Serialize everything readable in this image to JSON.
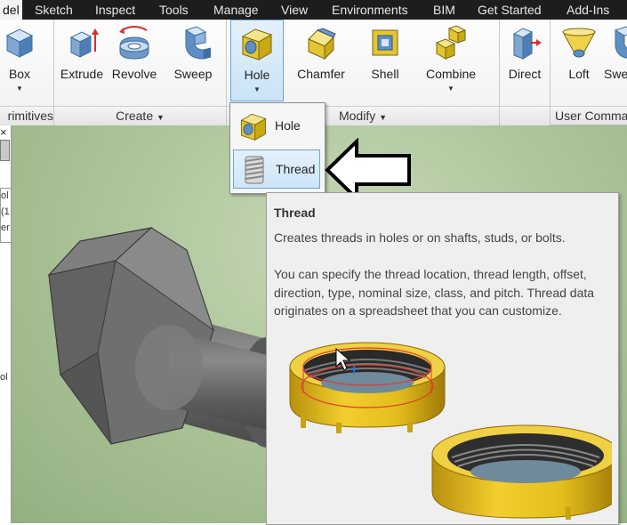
{
  "tabs": [
    "del",
    "Sketch",
    "Inspect",
    "Tools",
    "Manage",
    "View",
    "Environments",
    "BIM",
    "Get Started",
    "Add-Ins"
  ],
  "ribbon": {
    "buttons": {
      "box": "Box",
      "extrude": "Extrude",
      "revolve": "Revolve",
      "sweep": "Sweep",
      "hole": "Hole",
      "chamfer": "Chamfer",
      "shell": "Shell",
      "combine": "Combine",
      "direct": "Direct",
      "loft": "Loft",
      "sweep2": "Swe"
    },
    "panels": {
      "primitives": "rimitives",
      "create": "Create",
      "modify": "Modify",
      "user_commands": "User Comma"
    },
    "panel_arrow": "▼",
    "button_arrow": "▼"
  },
  "browser": {
    "close": "×",
    "fragments": [
      "ol",
      "(1",
      "er",
      "ol"
    ]
  },
  "hole_dropdown": {
    "items": [
      {
        "label": "Hole",
        "icon": "hole-icon"
      },
      {
        "label": "Thread",
        "icon": "thread-icon",
        "highlighted": true
      }
    ]
  },
  "tooltip": {
    "title": "Thread",
    "summary": "Creates threads in holes or on shafts, studs, or bolts.",
    "details": "You can specify the thread location, thread length, offset, direction, type, nominal size, class, and pitch. Thread data originates on a spreadsheet that you can customize."
  },
  "colors": {
    "tab_bar": "#1d1d1d",
    "accent_blue": "#6aa6d8",
    "model_gray": "#6f6f6f",
    "thread_gold": "#d8b21a"
  }
}
